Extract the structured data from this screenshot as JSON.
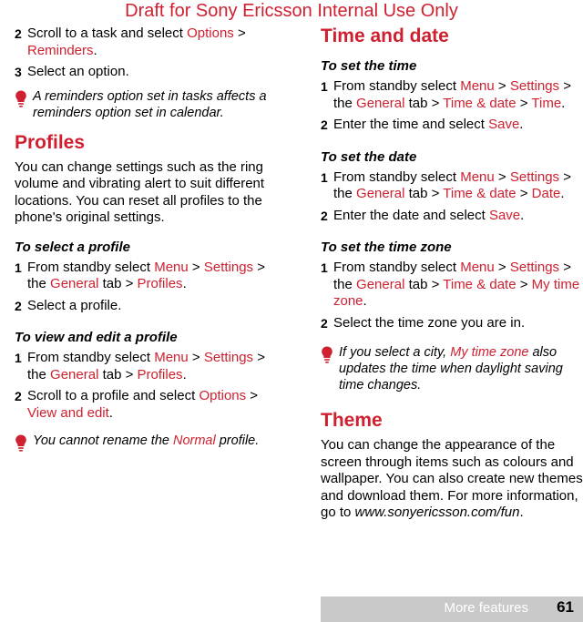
{
  "header": {
    "draft_notice": "Draft for Sony Ericsson Internal Use Only"
  },
  "footer": {
    "section_label": "More features",
    "page_number": "61"
  },
  "left_column": {
    "continued_steps": [
      {
        "num": "2",
        "parts": [
          {
            "t": "Scroll to a task and select ",
            "c": "plain"
          },
          {
            "t": "Options",
            "c": "ui"
          },
          {
            "t": " > ",
            "c": "plain"
          },
          {
            "t": "Reminders",
            "c": "ui"
          },
          {
            "t": ".",
            "c": "plain"
          }
        ]
      },
      {
        "num": "3",
        "parts": [
          {
            "t": "Select an option.",
            "c": "plain"
          }
        ]
      }
    ],
    "note_1": "A reminders option set in tasks affects a reminders option set in calendar.",
    "profiles": {
      "title": "Profiles",
      "body": "You can change settings such as the ring volume and vibrating alert to suit different locations. You can reset all profiles to the phone's original settings.",
      "select_profile": {
        "heading": "To select a profile",
        "steps": [
          {
            "num": "1",
            "parts": [
              {
                "t": "From standby select ",
                "c": "plain"
              },
              {
                "t": "Menu",
                "c": "ui"
              },
              {
                "t": " > ",
                "c": "plain"
              },
              {
                "t": "Settings",
                "c": "ui"
              },
              {
                "t": " > the ",
                "c": "plain"
              },
              {
                "t": "General",
                "c": "ui"
              },
              {
                "t": " tab > ",
                "c": "plain"
              },
              {
                "t": "Profiles",
                "c": "ui"
              },
              {
                "t": ".",
                "c": "plain"
              }
            ]
          },
          {
            "num": "2",
            "parts": [
              {
                "t": "Select a profile.",
                "c": "plain"
              }
            ]
          }
        ]
      },
      "view_edit_profile": {
        "heading": "To view and edit a profile",
        "steps": [
          {
            "num": "1",
            "parts": [
              {
                "t": "From standby select ",
                "c": "plain"
              },
              {
                "t": "Menu",
                "c": "ui"
              },
              {
                "t": " > ",
                "c": "plain"
              },
              {
                "t": "Settings",
                "c": "ui"
              },
              {
                "t": " > the ",
                "c": "plain"
              },
              {
                "t": "General",
                "c": "ui"
              },
              {
                "t": " tab > ",
                "c": "plain"
              },
              {
                "t": "Profiles",
                "c": "ui"
              },
              {
                "t": ".",
                "c": "plain"
              }
            ]
          },
          {
            "num": "2",
            "parts": [
              {
                "t": "Scroll to a profile and select ",
                "c": "plain"
              },
              {
                "t": "Options",
                "c": "ui"
              },
              {
                "t": " > ",
                "c": "plain"
              },
              {
                "t": "View and edit",
                "c": "ui"
              },
              {
                "t": ".",
                "c": "plain"
              }
            ]
          }
        ]
      },
      "note_2": [
        {
          "t": "You cannot rename the ",
          "c": "plain"
        },
        {
          "t": "Normal",
          "c": "ui"
        },
        {
          "t": " profile.",
          "c": "plain"
        }
      ]
    }
  },
  "right_column": {
    "time_and_date": {
      "title": "Time and date",
      "set_time": {
        "heading": "To set the time",
        "steps": [
          {
            "num": "1",
            "parts": [
              {
                "t": "From standby select ",
                "c": "plain"
              },
              {
                "t": "Menu",
                "c": "ui"
              },
              {
                "t": " > ",
                "c": "plain"
              },
              {
                "t": "Settings",
                "c": "ui"
              },
              {
                "t": " > the ",
                "c": "plain"
              },
              {
                "t": "General",
                "c": "ui"
              },
              {
                "t": " tab > ",
                "c": "plain"
              },
              {
                "t": "Time & date",
                "c": "ui"
              },
              {
                "t": " > ",
                "c": "plain"
              },
              {
                "t": "Time",
                "c": "ui"
              },
              {
                "t": ".",
                "c": "plain"
              }
            ]
          },
          {
            "num": "2",
            "parts": [
              {
                "t": "Enter the time and select ",
                "c": "plain"
              },
              {
                "t": "Save",
                "c": "ui"
              },
              {
                "t": ".",
                "c": "plain"
              }
            ]
          }
        ]
      },
      "set_date": {
        "heading": "To set the date",
        "steps": [
          {
            "num": "1",
            "parts": [
              {
                "t": "From standby select ",
                "c": "plain"
              },
              {
                "t": "Menu",
                "c": "ui"
              },
              {
                "t": " > ",
                "c": "plain"
              },
              {
                "t": "Settings",
                "c": "ui"
              },
              {
                "t": " > the ",
                "c": "plain"
              },
              {
                "t": "General",
                "c": "ui"
              },
              {
                "t": " tab > ",
                "c": "plain"
              },
              {
                "t": "Time & date",
                "c": "ui"
              },
              {
                "t": " > ",
                "c": "plain"
              },
              {
                "t": "Date",
                "c": "ui"
              },
              {
                "t": ".",
                "c": "plain"
              }
            ]
          },
          {
            "num": "2",
            "parts": [
              {
                "t": "Enter the date and select ",
                "c": "plain"
              },
              {
                "t": "Save",
                "c": "ui"
              },
              {
                "t": ".",
                "c": "plain"
              }
            ]
          }
        ]
      },
      "set_time_zone": {
        "heading": "To set the time zone",
        "steps": [
          {
            "num": "1",
            "parts": [
              {
                "t": "From standby select ",
                "c": "plain"
              },
              {
                "t": "Menu",
                "c": "ui"
              },
              {
                "t": " > ",
                "c": "plain"
              },
              {
                "t": "Settings",
                "c": "ui"
              },
              {
                "t": " > the ",
                "c": "plain"
              },
              {
                "t": "General",
                "c": "ui"
              },
              {
                "t": " tab > ",
                "c": "plain"
              },
              {
                "t": "Time & date",
                "c": "ui"
              },
              {
                "t": " > ",
                "c": "plain"
              },
              {
                "t": "My time zone",
                "c": "ui"
              },
              {
                "t": ".",
                "c": "plain"
              }
            ]
          },
          {
            "num": "2",
            "parts": [
              {
                "t": "Select the time zone you are in.",
                "c": "plain"
              }
            ]
          }
        ]
      },
      "note": [
        {
          "t": "If you select a city, ",
          "c": "plain"
        },
        {
          "t": "My time zone",
          "c": "ui"
        },
        {
          "t": " also updates the time when daylight saving time changes.",
          "c": "plain"
        }
      ]
    },
    "theme": {
      "title": "Theme",
      "body_parts": [
        {
          "t": "You can change the appearance of the screen through items such as colours and wallpaper. You can also create new themes and download them. For more information, go to ",
          "c": "plain"
        },
        {
          "t": "www.sonyericsson.com/fun",
          "c": "ital"
        },
        {
          "t": ".",
          "c": "plain"
        }
      ]
    }
  },
  "colors": {
    "accent": "#cf2030",
    "footer_bar": "#c9c9c9",
    "text": "#000000"
  },
  "icons": {
    "tip": "lightbulb-icon"
  }
}
